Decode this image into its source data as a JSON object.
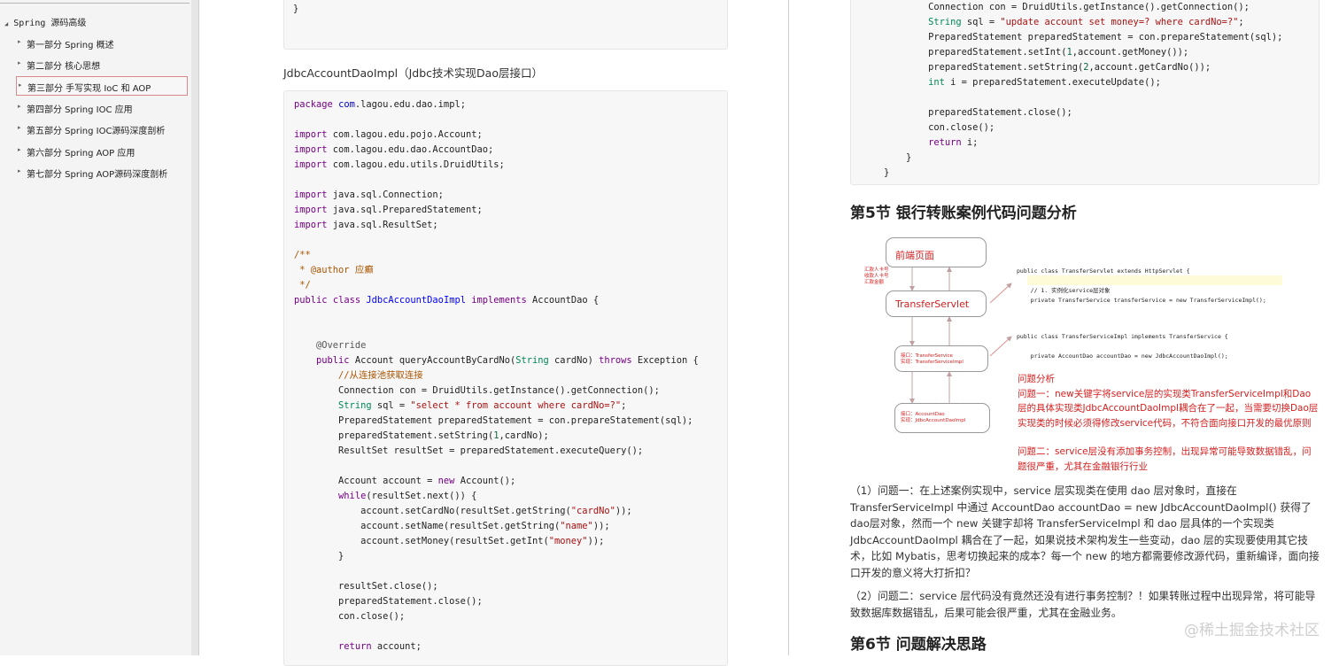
{
  "sidebar": {
    "root": "Spring 源码高级",
    "items": [
      {
        "label": "第一部分 Spring 概述"
      },
      {
        "label": "第二部分 核心思想"
      },
      {
        "label": "第三部分 手写实现 IoC 和 AOP"
      },
      {
        "label": "第四部分 Spring IOC 应用"
      },
      {
        "label": "第五部分 Spring IOC源码深度剖析"
      },
      {
        "label": "第六部分 Spring AOP 应用"
      },
      {
        "label": "第七部分 Spring AOP源码深度剖析"
      }
    ],
    "active_index": 2
  },
  "left_doc": {
    "top_brace": "}",
    "caption": "JdbcAccountDaoImpl（Jdbc技术实现Dao层接口）"
  },
  "right_doc": {
    "section5_title": "第5节 银行转账案例代码问题分析",
    "section6_title": "第6节 问题解决思路",
    "para1": "（1）问题一：在上述案例实现中，service 层实现类在使用 dao 层对象时，直接在 TransferServiceImpl 中通过 AccountDao accountDao = new JdbcAccountDaoImpl() 获得了 dao层对象，然而一个 new 关键字却将 TransferServiceImpl 和 dao 层具体的一个实现类 JdbcAccountDaoImpl 耦合在了一起，如果说技术架构发生一些变动，dao 层的实现要使用其它技术，比如 Mybatis，思考切换起来的成本？每一个 new 的地方都需要修改源代码，重新编译，面向接口开发的意义将大打折扣？",
    "para2": "（2）问题二：service 层代码没有竟然还没有进行事务控制？！如果转账过程中出现异常，将可能导致数据库数据错乱，后果可能会很严重，尤其在金融业务。"
  },
  "diagram": {
    "box_front": "前端页面",
    "box_servlet": "TransferServlet",
    "box_service": "接口：TransferService\n实现：TransferServiceImpl",
    "box_dao": "接口：AccountDao\n实现：JdbcAccountDaoImpl",
    "side_labels": "汇款人卡号\n收款人卡号\n汇款金额",
    "servlet_code": "public class TransferServlet extends HttpServlet {\n\n    // 1. 实例化service层对象\n    private TransferService transferService = new TransferServiceImpl();",
    "service_code": "public class TransferServiceImpl implements TransferService {\n\n    private AccountDao accountDao = new JdbcAccountDaoImpl();",
    "issue_title": "问题分析",
    "issue_1": "问题一：new关键字将service层的实现类TransferServiceImpl和Dao层的具体实现类JdbcAccountDaoImpl耦合在了一起，当需要切换Dao层实现类的时候必须得修改service代码，不符合面向接口开发的最优原则",
    "issue_2": "问题二：service层没有添加事务控制，出现异常可能导致数据错乱，问题很严重，尤其在金融银行行业"
  },
  "watermark": "@稀土掘金技术社区",
  "colors": {
    "keyword": "#770088",
    "type": "#008855",
    "string": "#aa1111",
    "comment": "#aa5500",
    "definition": "#0000ff",
    "diagram_red": "#d42020",
    "active_border": "#d98a8a"
  }
}
